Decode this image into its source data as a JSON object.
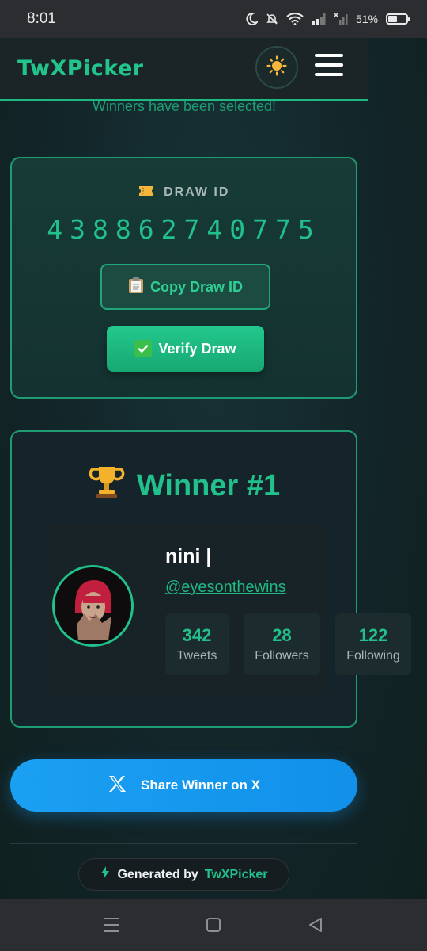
{
  "status_bar": {
    "time": "8:01",
    "battery_percent": "51%",
    "battery_level": 0.51,
    "icons": [
      "moon-icon",
      "bell-off-icon",
      "wifi-icon",
      "signal-icon",
      "signal-x-icon",
      "battery-icon"
    ]
  },
  "header": {
    "logo": "TwXPicker",
    "theme_icon": "sun-icon",
    "menu_icon": "hamburger-menu-icon"
  },
  "subtitle": "Winners have been selected!",
  "draw": {
    "label": "DRAW ID",
    "label_icon": "ticket-icon",
    "id": "438862740775",
    "copy_label": "Copy Draw ID",
    "copy_icon": "clipboard-icon",
    "verify_label": "Verify Draw",
    "verify_icon": "check-box-icon"
  },
  "winner": {
    "title": "Winner #1",
    "title_icon": "trophy-icon",
    "name": "nini |",
    "handle": "@eyesonthewins",
    "stats": [
      {
        "value": "342",
        "label": "Tweets"
      },
      {
        "value": "28",
        "label": "Followers"
      },
      {
        "value": "122",
        "label": "Following"
      }
    ]
  },
  "share": {
    "label": "Share Winner on X",
    "icon": "x-logo-icon"
  },
  "footer": {
    "generated_label": "Generated by",
    "brand": "TwXPicker",
    "icon": "lightning-icon"
  },
  "colors": {
    "accent": "#22c08b",
    "share_blue": "#1aa0f2",
    "background": "#14292c"
  },
  "nav_bar": {
    "icons": [
      "recent-apps-icon",
      "home-icon",
      "back-icon"
    ]
  }
}
